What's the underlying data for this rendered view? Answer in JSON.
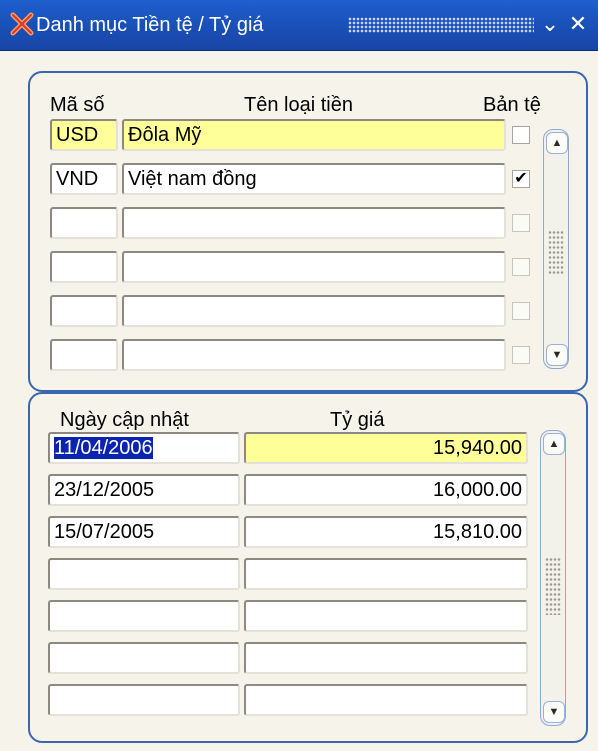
{
  "window": {
    "title": "Danh mục Tiền tệ / Tỷ giá",
    "minimize_glyph": "⌄",
    "close_glyph": "✕",
    "icon": "app-x-icon"
  },
  "currency": {
    "headers": {
      "code": "Mã số",
      "name": "Tên loại tiền",
      "base": "Bản tệ"
    },
    "rows": [
      {
        "code": "USD",
        "name": "Đôla Mỹ",
        "base": false
      },
      {
        "code": "VND",
        "name": "Việt nam đồng",
        "base": true
      },
      {
        "code": "",
        "name": "",
        "base": false
      },
      {
        "code": "",
        "name": "",
        "base": false
      },
      {
        "code": "",
        "name": "",
        "base": false
      },
      {
        "code": "",
        "name": "",
        "base": false
      }
    ],
    "check_glyph": "✔"
  },
  "rates": {
    "headers": {
      "date": "Ngày cập nhật",
      "rate": "Tỷ giá"
    },
    "rows": [
      {
        "date": "11/04/2006",
        "rate": "15,940.00"
      },
      {
        "date": "23/12/2005",
        "rate": "16,000.00"
      },
      {
        "date": "15/07/2005",
        "rate": "15,810.00"
      },
      {
        "date": "",
        "rate": ""
      },
      {
        "date": "",
        "rate": ""
      },
      {
        "date": "",
        "rate": ""
      },
      {
        "date": "",
        "rate": ""
      }
    ]
  },
  "scrollbar": {
    "up_glyph": "▲",
    "down_glyph": "▼"
  },
  "colors": {
    "titlebar": "#1a4fb5",
    "active_row": "#ffff99",
    "selection": "#0a24b0",
    "panel_border": "#3a66b0"
  }
}
